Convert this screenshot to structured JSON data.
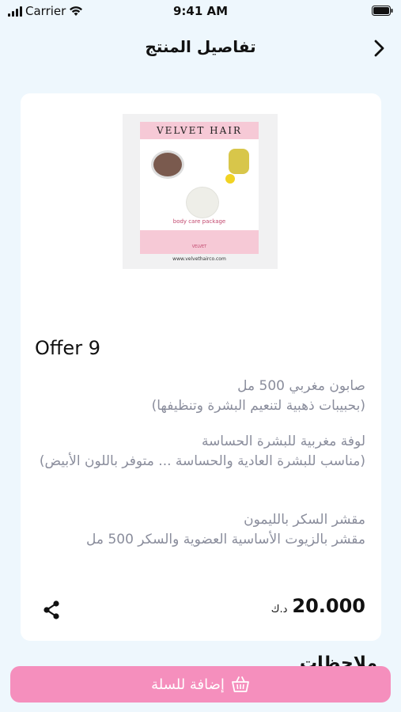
{
  "status_bar": {
    "carrier": "Carrier",
    "time": "9:41 AM"
  },
  "nav": {
    "title": "تفاصيل المنتج"
  },
  "product": {
    "image_text": {
      "brand": "VELVET HAIR",
      "package": "body care package",
      "footer_brand": "VELVET",
      "url": "www.velvethairco.com"
    },
    "name": "Offer 9",
    "description_items": [
      {
        "line1": "صابون مغربي 500 مل",
        "line2": "(بحبيبات ذهبية لتنعيم البشرة وتنظيفها)"
      },
      {
        "line1": "لوفة مغربية للبشرة الحساسة",
        "line2": "(مناسب للبشرة العادية والحساسة ... متوفر باللون الأبيض)"
      },
      {
        "line1": "مقشر السكر بالليمون",
        "line2": "مقشر بالزيوت الأساسية العضوية والسكر 500 مل"
      }
    ],
    "price": "20.000",
    "currency": "د.ك"
  },
  "section": {
    "heading": "ملاحظات"
  },
  "cart_button": {
    "label": "إضافة للسلة",
    "icon": "basket-icon"
  },
  "colors": {
    "accent": "#f58fbd",
    "background": "#eef7fd",
    "muted_text": "#8a8d9c"
  }
}
